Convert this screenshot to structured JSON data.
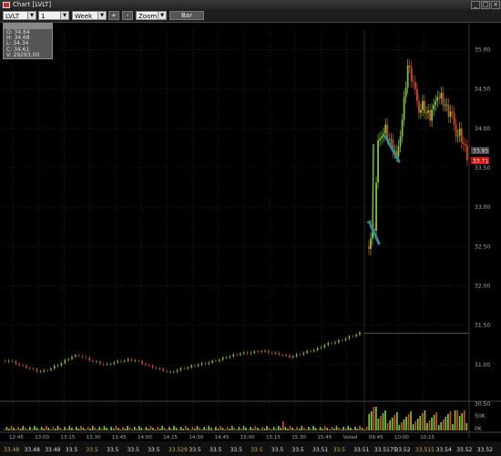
{
  "window": {
    "title": "Chart [LVLT]",
    "buttons": [
      "_",
      "□",
      "×"
    ]
  },
  "toolbar": {
    "symbol": "LVLT",
    "interval": "1 minute",
    "range": "Week",
    "zoom_in_label": "+",
    "zoom_out_label": "-",
    "zoom_select": "Zoom",
    "bar_button": "Bar"
  },
  "info_box": {
    "header": "",
    "lines": [
      "O: 34.64",
      "H: 34.68",
      "L: 34.34",
      "C: 34.61",
      "V: 29293.00"
    ]
  },
  "chart_data": {
    "type": "candlestick",
    "symbol": "LVLT",
    "interval": "1 minute",
    "price_axis_ticks": [
      "35.00",
      "34.50",
      "34.00",
      "33.50",
      "33.00",
      "32.50",
      "32.00",
      "31.50",
      "31.00",
      "30.50"
    ],
    "ylim": [
      30.5,
      35.25
    ],
    "time_axis_ticks": [
      "12:45",
      "13:00",
      "13:15",
      "13:30",
      "13:45",
      "14:00",
      "14:15",
      "14:30",
      "14:45",
      "15:00",
      "15:15",
      "15:30",
      "15:45",
      "Voted",
      "09:45",
      "10:00",
      "10:15"
    ],
    "last_price_labels": [
      "33.85",
      "33.71"
    ],
    "volume_axis_ticks": [
      "50K",
      "0K"
    ],
    "series_day1_close": [
      31.05,
      31.02,
      30.98,
      30.95,
      30.92,
      30.92,
      30.95,
      31.0,
      31.05,
      31.1,
      31.12,
      31.08,
      31.04,
      31.02,
      31.0,
      31.03,
      31.05,
      31.06,
      31.05,
      31.02,
      30.98,
      30.95,
      30.93,
      30.9,
      30.93,
      30.96,
      30.98,
      31.0,
      31.02,
      31.04,
      31.06,
      31.1,
      31.12,
      31.14,
      31.15,
      31.16,
      31.17,
      31.16,
      31.14,
      31.12,
      31.1,
      31.12,
      31.15,
      31.18,
      31.2,
      31.25,
      31.28,
      31.3,
      31.33,
      31.37,
      31.4
    ],
    "series_day2_close": [
      32.6,
      32.7,
      33.85,
      33.9,
      34.05,
      33.85,
      33.7,
      33.65,
      33.9,
      34.4,
      34.8,
      34.6,
      34.5,
      34.2,
      34.35,
      34.2,
      34.1,
      34.3,
      34.4,
      34.45,
      34.3,
      34.15,
      34.2,
      33.9,
      34.0,
      33.8,
      33.6
    ]
  },
  "bottom_prices": [
    "33.48",
    "33.48",
    "33.49",
    "33.5",
    "33.5",
    "33.5",
    "33.5",
    "33.5",
    "33.529",
    "33.5",
    "33.5",
    "33.5",
    "33.5",
    "33.5",
    "33.5",
    "33.51",
    "33.5",
    "33.51",
    "33.5175",
    "33.52",
    "33.515",
    "33.54",
    "33.52",
    "33.52"
  ],
  "colors": {
    "background": "#000000",
    "up_candle": "#7ec43a",
    "down_candle": "#d14a1c",
    "last_price_label": "#d01010",
    "arrow": "#2e8a96",
    "grid": "#2a2a2a"
  }
}
